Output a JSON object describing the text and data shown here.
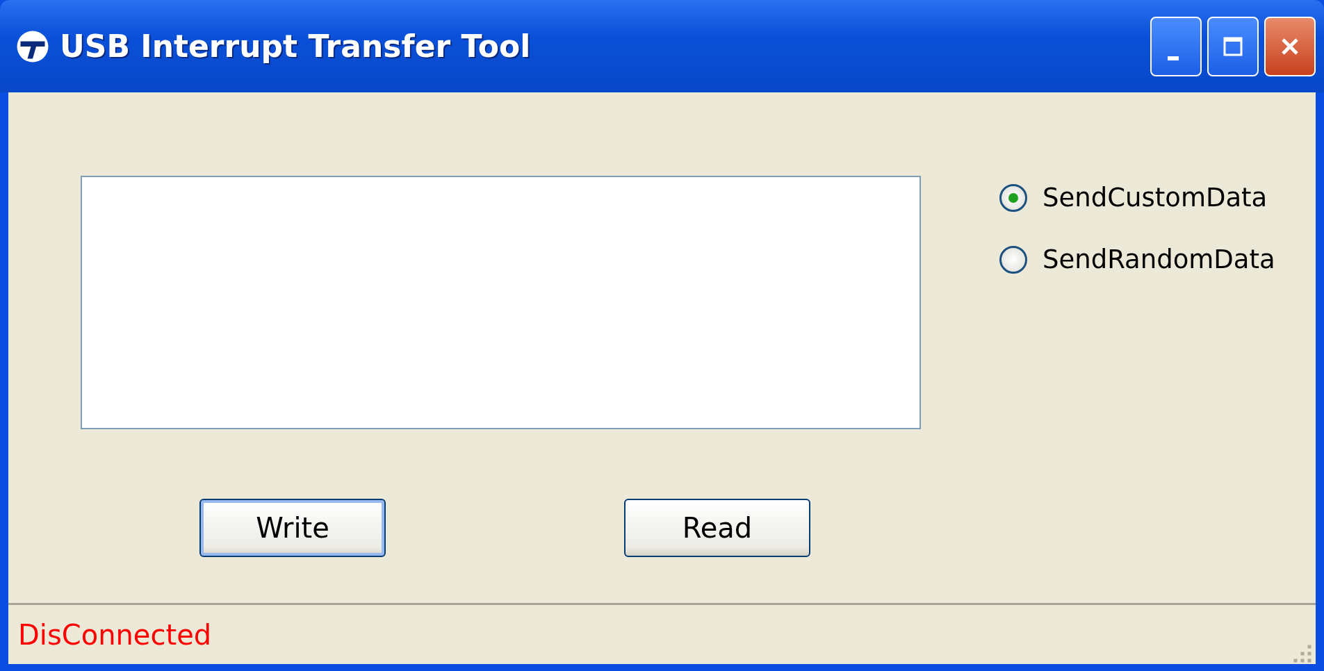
{
  "window": {
    "title": "USB Interrupt Transfer Tool"
  },
  "options": [
    {
      "label": "SendCustomData",
      "selected": true
    },
    {
      "label": "SendRandomData",
      "selected": false
    }
  ],
  "buttons": [
    {
      "label": "Write",
      "focused": true
    },
    {
      "label": "Read",
      "focused": false
    }
  ],
  "status_bar": {
    "text": "DisConnected"
  }
}
